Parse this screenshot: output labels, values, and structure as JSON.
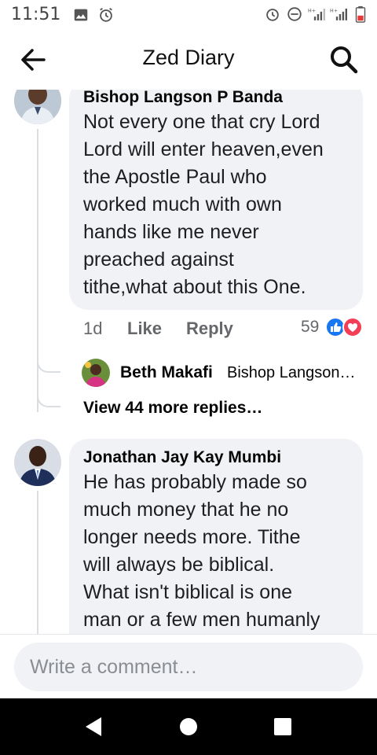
{
  "status_bar": {
    "time": "11:51",
    "icons_left": [
      "gallery-icon",
      "alarm-icon"
    ],
    "icons_right": [
      "alarm-icon",
      "do-not-disturb-icon",
      "signal-icon",
      "signal-icon",
      "battery-icon"
    ]
  },
  "header": {
    "title": "Zed Diary",
    "back_icon": "arrow-left-icon",
    "search_icon": "search-icon"
  },
  "comments": [
    {
      "author": "Bishop Langson P Banda",
      "text": "Not every one that cry Lord Lord will enter heaven,even the Apostle Paul who worked much with own hands like me never preached against tithe,what about this One.",
      "lines": [
        "Not every one that cry Lord",
        "Lord will enter heaven,even",
        "the Apostle Paul who",
        "worked much with own",
        "hands like me never",
        "preached against",
        "tithe,what about this One."
      ],
      "time": "1d",
      "like_label": "Like",
      "reply_label": "Reply",
      "reaction_count": "59",
      "reply_preview": {
        "author": "Beth Makafi",
        "snippet": "Bishop Langson…"
      },
      "more_replies": "View 44 more replies…"
    },
    {
      "author": "Jonathan Jay Kay Mumbi",
      "lines": [
        "He has probably made so",
        "much money that he no",
        "longer needs more. Tithe",
        "will always be biblical.",
        "What isn't biblical is one",
        "man or a few men humanly"
      ]
    }
  ],
  "composer": {
    "placeholder": "Write a comment…"
  },
  "colors": {
    "bubble": "#f0f2f5",
    "like_blue": "#1877f2",
    "love_red": "#f33e58",
    "meta_gray": "#65676b"
  }
}
